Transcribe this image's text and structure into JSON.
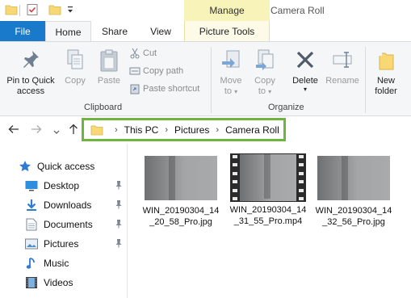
{
  "titlebar": {
    "context_tab": "Manage",
    "window_title": "Camera Roll"
  },
  "tabs": {
    "file": "File",
    "home": "Home",
    "share": "Share",
    "view": "View",
    "picture_tools": "Picture Tools"
  },
  "ribbon": {
    "pin_to_quick_access_line1": "Pin to Quick",
    "pin_to_quick_access_line2": "access",
    "copy": "Copy",
    "paste": "Paste",
    "cut": "Cut",
    "copy_path": "Copy path",
    "paste_shortcut": "Paste shortcut",
    "clipboard_group": "Clipboard",
    "move_to_line1": "Move",
    "move_to_line2": "to",
    "copy_to_line1": "Copy",
    "copy_to_line2": "to",
    "delete": "Delete",
    "rename": "Rename",
    "new_folder_line1": "New",
    "new_folder_line2": "folder",
    "organize_group": "Organize"
  },
  "address": {
    "crumbs": [
      "This PC",
      "Pictures",
      "Camera Roll"
    ],
    "separator": "›"
  },
  "navpane": {
    "items": [
      {
        "label": "Quick access",
        "icon": "star-icon"
      },
      {
        "label": "Desktop",
        "icon": "desktop-icon",
        "pinned": true
      },
      {
        "label": "Downloads",
        "icon": "downloads-icon",
        "pinned": true
      },
      {
        "label": "Documents",
        "icon": "documents-icon",
        "pinned": true
      },
      {
        "label": "Pictures",
        "icon": "pictures-icon",
        "pinned": true
      },
      {
        "label": "Music",
        "icon": "music-icon"
      },
      {
        "label": "Videos",
        "icon": "videos-icon"
      }
    ]
  },
  "files": [
    {
      "name": "WIN_20190304_14_20_58_Pro.jpg",
      "type": "image"
    },
    {
      "name": "WIN_20190304_14_31_55_Pro.mp4",
      "type": "video"
    },
    {
      "name": "WIN_20190304_14_32_56_Pro.jpg",
      "type": "image"
    }
  ],
  "colors": {
    "file_tab": "#1979ca",
    "context_tab": "#f8f3b8",
    "address_highlight": "#6fb43f"
  }
}
